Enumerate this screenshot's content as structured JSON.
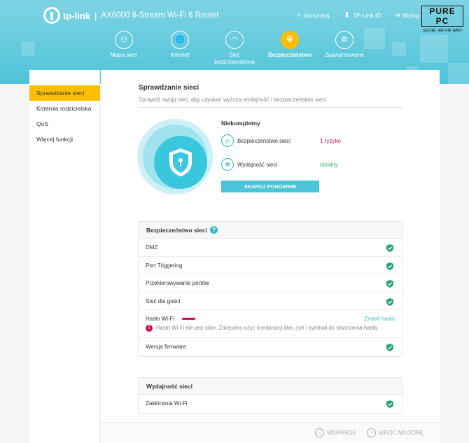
{
  "header": {
    "brand": "tp-link",
    "model": "AX6000 8-Stream Wi-Fi 6 Router",
    "search_label": "Wyszukaj",
    "account_label": "TP-Link ID",
    "logout_label": "Wylog",
    "badge_top": "PURE PC",
    "badge_bottom": "sprzęt, ale nie tylko"
  },
  "main_nav": [
    {
      "label": "Mapa sieci",
      "icon": "network-map-icon"
    },
    {
      "label": "Internet",
      "icon": "globe-icon"
    },
    {
      "label": "Sieć bezprzewodowa",
      "icon": "wifi-icon"
    },
    {
      "label": "Bezpieczeństwo",
      "icon": "shield-icon",
      "active": true
    },
    {
      "label": "Zaawansowane",
      "icon": "gear-icon"
    }
  ],
  "sidebar": {
    "items": [
      {
        "label": "Sprawdzanie sieci",
        "active": true
      },
      {
        "label": "Kontrola rodzicielska"
      },
      {
        "label": "QoS"
      },
      {
        "label": "Więcej funkcji"
      }
    ]
  },
  "main": {
    "title": "Sprawdzanie sieci",
    "description": "Sprawdź swoją sieć, aby uzyskać wyższą wydajność i bezpieczeństwo sieci.",
    "status_title": "Niekompletny",
    "security_label": "Bezpieczeństwo sieci",
    "security_value": "1 ryzyko",
    "performance_label": "Wydajność sieci",
    "performance_value": "Idealny",
    "rescan_button": "SKANUJ PONOWNIE"
  },
  "security_card": {
    "title": "Bezpieczeństwo sieci",
    "rows": [
      "DMZ",
      "Port Triggering",
      "Przekierowywanie portów",
      "Sieć dla gości"
    ],
    "wifi_password_label": "Hasło Wi-Fi",
    "change_password": "Zmień hasło",
    "wifi_warning": "Hasło Wi-Fi nie jest silne. Zalecamy użyć kombinacji liter, cyfr i symboli do stworzenia hasła.",
    "firmware_label": "Wersja firmware"
  },
  "performance_card": {
    "title": "Wydajność sieci",
    "rows": [
      "Zakłócenia Wi-Fi"
    ]
  },
  "footer": {
    "support": "WSPARCIE",
    "back_to_top": "WRÓĆ NA GÓRĘ"
  },
  "colors": {
    "accent": "#4fc3d9",
    "active_nav": "#ffbf00",
    "risk": "#c8125b",
    "ok": "#2bb673",
    "check": "#2aa37a"
  }
}
